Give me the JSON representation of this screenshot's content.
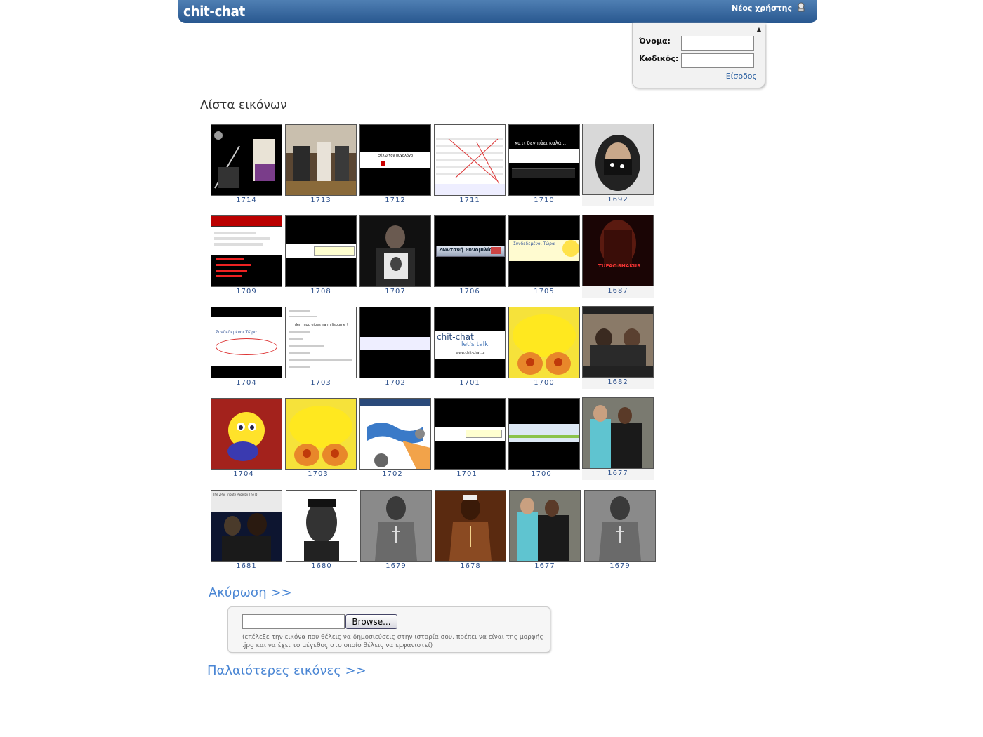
{
  "header": {
    "logo": "chit-chat",
    "new_user": "Νέος χρήστης"
  },
  "login": {
    "name_label": "Όνομα:",
    "password_label": "Κωδικός:",
    "name_value": "",
    "password_value": "",
    "submit": "Είσοδος"
  },
  "gallery": {
    "title": "Λίστα εικόνων",
    "images": [
      {
        "id": "1714",
        "icon": "samurai-art-thumb"
      },
      {
        "id": "1713",
        "icon": "photo-room-thumb"
      },
      {
        "id": "1712",
        "icon": "chat-screenshot-thumb"
      },
      {
        "id": "1711",
        "icon": "chat-screenshot-thumb"
      },
      {
        "id": "1710",
        "icon": "chat-screenshot-thumb"
      },
      {
        "id": "1692",
        "icon": "masked-person-thumb"
      },
      {
        "id": "1709",
        "icon": "chat-screenshot-thumb"
      },
      {
        "id": "1708",
        "icon": "chat-screenshot-thumb"
      },
      {
        "id": "1707",
        "icon": "portrait-photo-thumb"
      },
      {
        "id": "1706",
        "icon": "chat-banner-thumb"
      },
      {
        "id": "1705",
        "icon": "chat-screenshot-thumb"
      },
      {
        "id": "1687",
        "icon": "poster-thumb"
      },
      {
        "id": "1704",
        "icon": "chat-screenshot-thumb"
      },
      {
        "id": "1703",
        "icon": "chat-log-thumb"
      },
      {
        "id": "1702",
        "icon": "chat-screenshot-thumb"
      },
      {
        "id": "1701",
        "icon": "chit-chat-logo-thumb"
      },
      {
        "id": "1700",
        "icon": "tweety-thumb"
      },
      {
        "id": "1682",
        "icon": "group-photo-thumb"
      },
      {
        "id": "1704",
        "icon": "tweety-thumb"
      },
      {
        "id": "1703",
        "icon": "tweety-thumb"
      },
      {
        "id": "1702",
        "icon": "infographic-thumb"
      },
      {
        "id": "1701",
        "icon": "chat-screenshot-thumb"
      },
      {
        "id": "1700",
        "icon": "chat-screenshot-thumb"
      },
      {
        "id": "1677",
        "icon": "group-photo-thumb"
      },
      {
        "id": "1681",
        "icon": "portrait-photo-thumb"
      },
      {
        "id": "1680",
        "icon": "portrait-photo-thumb"
      },
      {
        "id": "1679",
        "icon": "portrait-photo-thumb"
      },
      {
        "id": "1678",
        "icon": "portrait-photo-thumb"
      },
      {
        "id": "1677",
        "icon": "group-photo-thumb"
      },
      {
        "id": "1679",
        "icon": "portrait-photo-thumb"
      }
    ],
    "thumb_texts": {
      "t1712": "Θέλω τον ψυχολόγο",
      "t1710": "κατι δεν πάει καλά...",
      "t1706": "Ζωντανή Συνομιλία",
      "t1705": "Συνδεδεμένοι Τώρα",
      "t1704": "Συνδεδεμένοι Τώρα",
      "t1687": "TUPAC SHAKUR",
      "t1701a": "chit-chat",
      "t1701b": "let's talk",
      "t1701c": "www.chit-chat.gr",
      "t1703": "den mou eipes na milisoume ?",
      "t1681": "The 2Pac Tribute Page by The D"
    }
  },
  "actions": {
    "cancel": "Ακύρωση >>",
    "older": "Παλαιότερες εικόνες >>"
  },
  "upload": {
    "browse": "Browse...",
    "file_value": "",
    "note": "(επέλεξε την εικόνα που θέλεις να δημοσιεύσεις στην ιστορία σου, πρέπει να είναι της μορφής .jpg και να έχει το μέγεθος στο οποίο θέλεις να εμφανιστεί)"
  }
}
